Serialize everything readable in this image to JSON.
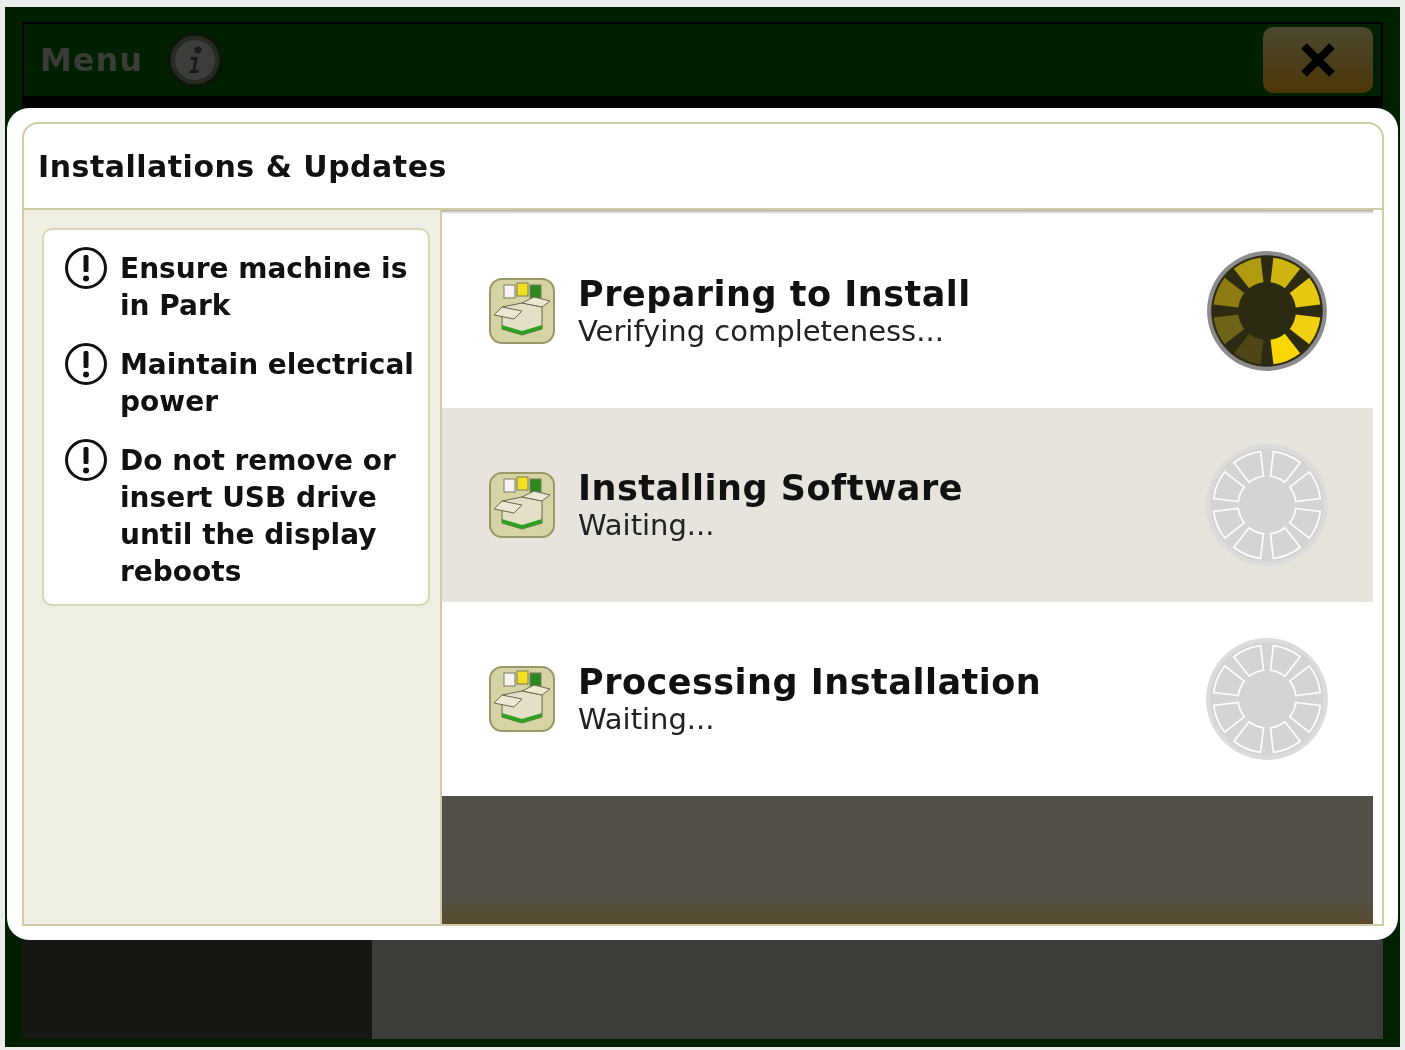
{
  "top_bar": {
    "title": "Menu"
  },
  "dialog": {
    "title": "Installations & Updates",
    "notices": [
      "Ensure machine is in Park",
      "Maintain electrical power",
      "Do not remove or insert USB drive until the display reboots"
    ],
    "steps": [
      {
        "title": "Preparing to Install",
        "status_text": "Verifying completeness...",
        "kind": "active"
      },
      {
        "title": "Installing Software",
        "status_text": "Waiting...",
        "kind": "waiting"
      },
      {
        "title": "Processing Installation",
        "status_text": "Waiting...",
        "kind": "waiting"
      }
    ]
  }
}
